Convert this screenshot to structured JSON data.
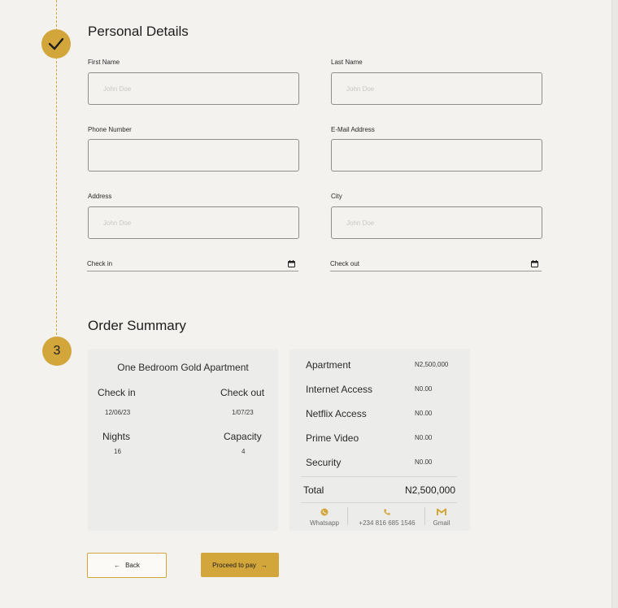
{
  "personal_details": {
    "title": "Personal Details",
    "fields": {
      "first_name": {
        "label": "First Name",
        "placeholder": "John Doe"
      },
      "last_name": {
        "label": "Last Name",
        "placeholder": "John Doe"
      },
      "phone": {
        "label": "Phone Number",
        "placeholder": ""
      },
      "email": {
        "label": "E-Mail Address",
        "placeholder": ""
      },
      "address": {
        "label": "Address",
        "placeholder": "John Doe"
      },
      "city": {
        "label": "City",
        "placeholder": "John Doe"
      },
      "check_in": {
        "label": "Check in"
      },
      "check_out": {
        "label": "Check out"
      }
    }
  },
  "order_summary": {
    "step_number": "3",
    "title": "Order Summary",
    "apartment_name": "One Bedroom Gold Apartment",
    "check_in_label": "Check in",
    "check_in_value": "12/06/23",
    "check_out_label": "Check out",
    "check_out_value": "1/07/23",
    "nights_label": "Nights",
    "nights_value": "16",
    "capacity_label": "Capacity",
    "capacity_value": "4",
    "items": [
      {
        "label": "Apartment",
        "value": "N2,500,000"
      },
      {
        "label": "Internet Access",
        "value": "N0.00"
      },
      {
        "label": "Netflix Access",
        "value": "N0.00"
      },
      {
        "label": "Prime Video",
        "value": "N0.00"
      },
      {
        "label": "Security",
        "value": "N0.00"
      }
    ],
    "total_label": "Total",
    "total_value": "N2,500,000",
    "contacts": {
      "whatsapp": "Whatsapp",
      "phone": "+234 816 685 1546",
      "gmail": "Gmail"
    }
  },
  "buttons": {
    "back": "Back",
    "proceed": "Proceed to pay"
  },
  "colors": {
    "accent": "#d2a63a",
    "background": "#f3f2ef",
    "card": "#ececea"
  }
}
